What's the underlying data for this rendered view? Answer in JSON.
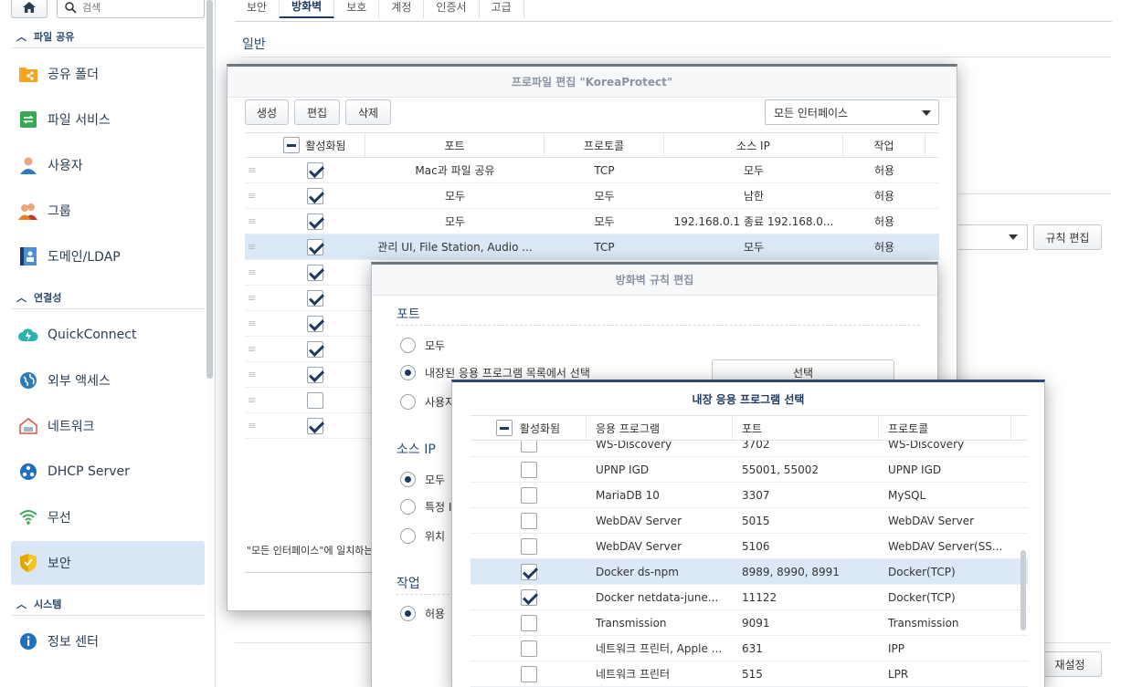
{
  "sidebar": {
    "search_placeholder": "검색",
    "sections": {
      "file_sharing": "파일 공유",
      "connectivity": "연결성",
      "system": "시스템"
    },
    "items": [
      {
        "label": "공유 폴더",
        "icon": "shared-folder-icon"
      },
      {
        "label": "파일 서비스",
        "icon": "file-services-icon"
      },
      {
        "label": "사용자",
        "icon": "user-icon"
      },
      {
        "label": "그룹",
        "icon": "group-icon"
      },
      {
        "label": "도메인/LDAP",
        "icon": "domain-ldap-icon"
      },
      {
        "label": "QuickConnect",
        "icon": "quickconnect-icon"
      },
      {
        "label": "외부 액세스",
        "icon": "external-access-icon"
      },
      {
        "label": "네트워크",
        "icon": "network-icon"
      },
      {
        "label": "DHCP Server",
        "icon": "dhcp-server-icon"
      },
      {
        "label": "무선",
        "icon": "wireless-icon"
      },
      {
        "label": "보안",
        "icon": "security-shield-icon"
      },
      {
        "label": "정보 센터",
        "icon": "info-center-icon"
      }
    ]
  },
  "main": {
    "tabs": [
      "보안",
      "방화벽",
      "보호",
      "계정",
      "인증서",
      "고급"
    ],
    "active_tab": "방화벽",
    "general_label": "일반",
    "rule_edit_label": "규칙 편집",
    "reset_label": "재설정"
  },
  "profile_dialog": {
    "title": "프로파일 편집 \"KoreaProtect\"",
    "buttons": {
      "create": "생성",
      "edit": "편집",
      "delete": "삭제"
    },
    "interface_select": "모든 인터페이스",
    "columns": {
      "enabled": "활성화됨",
      "port": "포트",
      "protocol": "프로토콜",
      "source_ip": "소스 IP",
      "action": "작업"
    },
    "rows": [
      {
        "enabled": true,
        "port": "Mac과 파일 공유",
        "protocol": "TCP",
        "source": "모두",
        "action": "허용"
      },
      {
        "enabled": true,
        "port": "모두",
        "protocol": "모두",
        "source": "남한",
        "action": "허용"
      },
      {
        "enabled": true,
        "port": "모두",
        "protocol": "모두",
        "source": "192.168.0.1 종료 192.168.0...",
        "action": "허용"
      },
      {
        "enabled": true,
        "port": "관리 UI, File Station, Audio ...",
        "protocol": "TCP",
        "source": "모두",
        "action": "허용"
      },
      {
        "enabled": true,
        "port": "",
        "protocol": "",
        "source": "",
        "action": ""
      },
      {
        "enabled": true,
        "port": "",
        "protocol": "",
        "source": "",
        "action": ""
      },
      {
        "enabled": true,
        "port": "",
        "protocol": "",
        "source": "",
        "action": ""
      },
      {
        "enabled": true,
        "port": "",
        "protocol": "",
        "source": "",
        "action": ""
      },
      {
        "enabled": true,
        "port": "",
        "protocol": "",
        "source": "",
        "action": ""
      },
      {
        "enabled": false,
        "port": "",
        "protocol": "",
        "source": "",
        "action": ""
      },
      {
        "enabled": true,
        "port": "",
        "protocol": "",
        "source": "",
        "action": ""
      }
    ],
    "note": "\"모든 인터페이스\"에 일치하는"
  },
  "rule_dialog": {
    "title": "방화벽 규칙 편집",
    "port_section": "포트",
    "port_options": [
      "모두",
      "내장된 응용 프로그램 목록에서 선택",
      "사용자"
    ],
    "select_button": "선택",
    "source_section": "소스 IP",
    "source_options": [
      "모두",
      "특정 I",
      "위치"
    ],
    "action_section": "작업",
    "action_options": [
      "허용"
    ]
  },
  "app_dialog": {
    "title": "내장 응용 프로그램 선택",
    "columns": {
      "enabled": "활성화됨",
      "app": "응용 프로그램",
      "port": "포트",
      "protocol": "프로토콜"
    },
    "rows": [
      {
        "enabled": false,
        "app": "WS-Discovery",
        "port": "3702",
        "protocol": "WS-Discovery"
      },
      {
        "enabled": false,
        "app": "UPNP IGD",
        "port": "55001, 55002",
        "protocol": "UPNP IGD"
      },
      {
        "enabled": false,
        "app": "MariaDB 10",
        "port": "3307",
        "protocol": "MySQL"
      },
      {
        "enabled": false,
        "app": "WebDAV Server",
        "port": "5015",
        "protocol": "WebDAV Server"
      },
      {
        "enabled": false,
        "app": "WebDAV Server",
        "port": "5106",
        "protocol": "WebDAV Server(SS..."
      },
      {
        "enabled": true,
        "app": "Docker ds-npm",
        "port": "8989, 8990, 8991",
        "protocol": "Docker(TCP)"
      },
      {
        "enabled": true,
        "app": "Docker netdata-june...",
        "port": "11122",
        "protocol": "Docker(TCP)"
      },
      {
        "enabled": false,
        "app": "Transmission",
        "port": "9091",
        "protocol": "Transmission"
      },
      {
        "enabled": false,
        "app": "네트워크 프린터, Apple ...",
        "port": "631",
        "protocol": "IPP"
      },
      {
        "enabled": false,
        "app": "네트워크 프린터",
        "port": "515",
        "protocol": "LPR"
      }
    ]
  }
}
